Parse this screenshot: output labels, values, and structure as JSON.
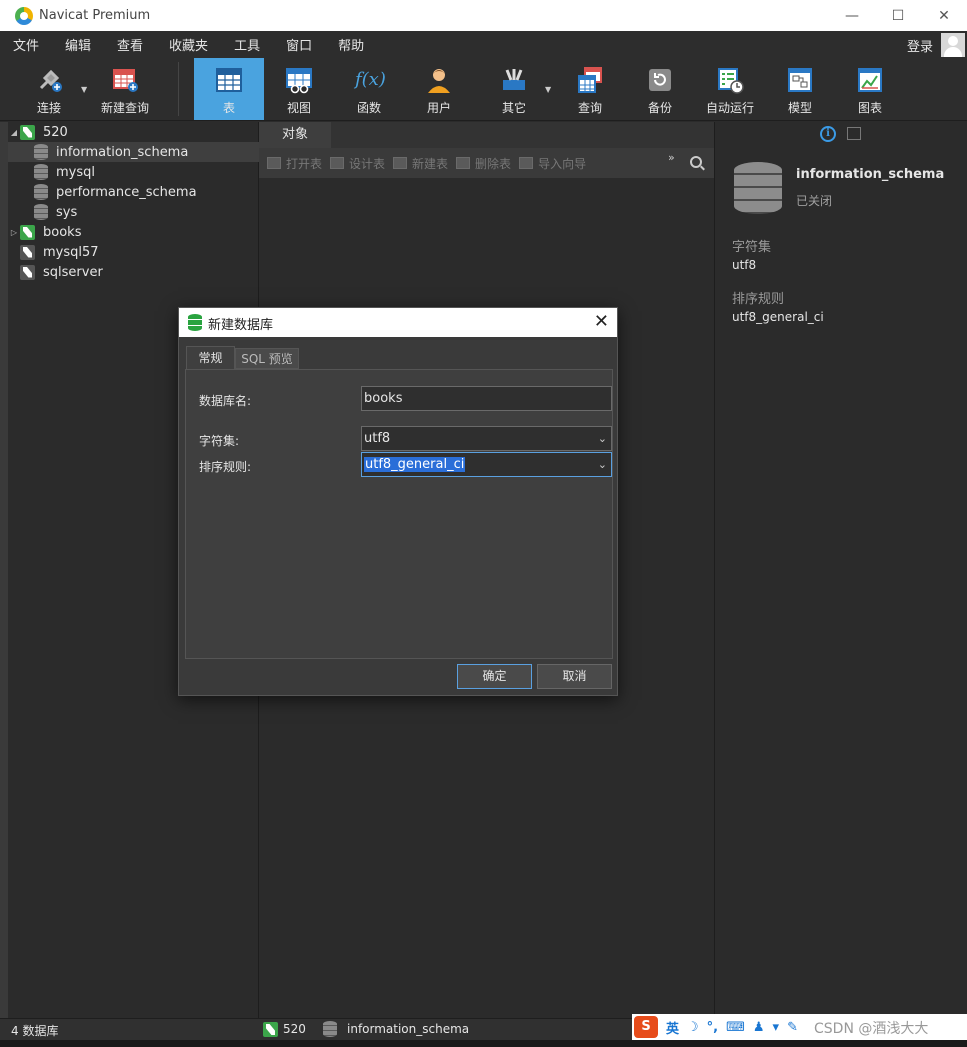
{
  "window": {
    "title": "Navicat Premium",
    "controls": {
      "minimize": "—",
      "maximize": "☐",
      "close": "✕"
    }
  },
  "menu": {
    "items": [
      "文件",
      "编辑",
      "查看",
      "收藏夹",
      "工具",
      "窗口",
      "帮助"
    ],
    "login": "登录"
  },
  "toolbar": {
    "items": [
      {
        "label": "连接",
        "icon": "plug-icon"
      },
      {
        "label": "新建查询",
        "icon": "new-query-icon"
      },
      {
        "label": "表",
        "icon": "table-icon",
        "active": true
      },
      {
        "label": "视图",
        "icon": "view-icon"
      },
      {
        "label": "函数",
        "icon": "function-icon",
        "glyph": "f(x)"
      },
      {
        "label": "用户",
        "icon": "user-icon"
      },
      {
        "label": "其它",
        "icon": "other-icon"
      },
      {
        "label": "查询",
        "icon": "query-icon"
      },
      {
        "label": "备份",
        "icon": "backup-icon"
      },
      {
        "label": "自动运行",
        "icon": "schedule-icon"
      },
      {
        "label": "模型",
        "icon": "model-icon"
      },
      {
        "label": "图表",
        "icon": "chart-icon"
      }
    ],
    "accent": "#4aa3df"
  },
  "tree": {
    "nodes": [
      {
        "label": "520",
        "type": "connection",
        "expanded": true
      },
      {
        "label": "information_schema",
        "type": "database",
        "selected": true
      },
      {
        "label": "mysql",
        "type": "database"
      },
      {
        "label": "performance_schema",
        "type": "database"
      },
      {
        "label": "sys",
        "type": "database"
      },
      {
        "label": "books",
        "type": "connection"
      },
      {
        "label": "mysql57",
        "type": "connection"
      },
      {
        "label": "sqlserver",
        "type": "connection"
      }
    ]
  },
  "center": {
    "tab": "对象",
    "actions": [
      "打开表",
      "设计表",
      "新建表",
      "删除表",
      "导入向导"
    ],
    "more": "»"
  },
  "details": {
    "name": "information_schema",
    "state": "已关闭",
    "charset_label": "字符集",
    "charset_value": "utf8",
    "collation_label": "排序规则",
    "collation_value": "utf8_general_ci"
  },
  "dialog": {
    "title": "新建数据库",
    "tabs": [
      "常规",
      "SQL 预览"
    ],
    "fields": {
      "dbname_label": "数据库名:",
      "dbname_value": "books",
      "charset_label": "字符集:",
      "charset_value": "utf8",
      "collation_label": "排序规则:",
      "collation_value": "utf8_general_ci"
    },
    "ok": "确定",
    "cancel": "取消"
  },
  "status": {
    "db_count": "4 数据库",
    "connection": "520",
    "database": "information_schema"
  },
  "ime": {
    "lang": "英",
    "watermark": "CSDN @酒浅大大"
  }
}
